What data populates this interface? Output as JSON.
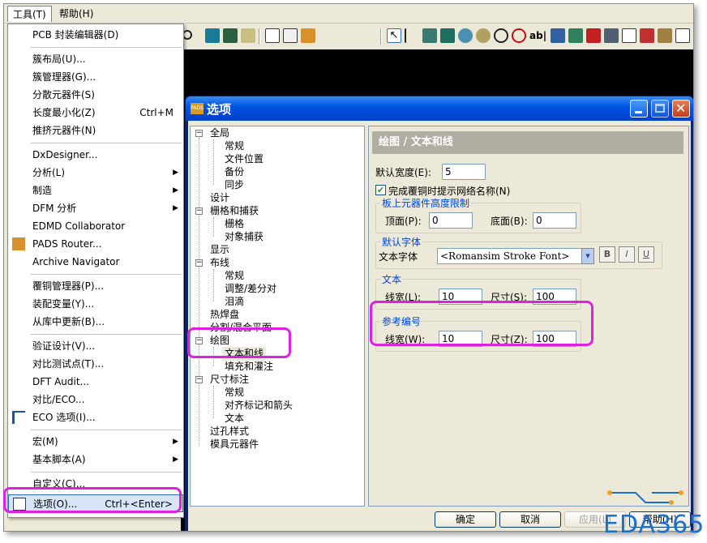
{
  "menubar": {
    "tools": "工具(T)",
    "help": "帮助(H)"
  },
  "tools_menu": {
    "items": [
      {
        "label": "PCB 封装编辑器(D)",
        "shortcut": "",
        "submenu": false
      },
      {
        "label": "簇布局(U)...",
        "shortcut": "",
        "submenu": false
      },
      {
        "label": "簇管理器(G)...",
        "shortcut": "",
        "submenu": false
      },
      {
        "label": "分散元器件(S)",
        "shortcut": "",
        "submenu": false
      },
      {
        "label": "长度最小化(Z)",
        "shortcut": "Ctrl+M",
        "submenu": false
      },
      {
        "label": "推挤元器件(N)",
        "shortcut": "",
        "submenu": false
      },
      {
        "label": "DxDesigner...",
        "shortcut": "",
        "submenu": false
      },
      {
        "label": "分析(L)",
        "shortcut": "",
        "submenu": true
      },
      {
        "label": "制造",
        "shortcut": "",
        "submenu": true
      },
      {
        "label": "DFM 分析",
        "shortcut": "",
        "submenu": true
      },
      {
        "label": "EDMD Collaborator",
        "shortcut": "",
        "submenu": false
      },
      {
        "label": "PADS Router...",
        "shortcut": "",
        "submenu": false
      },
      {
        "label": "Archive Navigator",
        "shortcut": "",
        "submenu": false
      },
      {
        "label": "覆铜管理器(P)...",
        "shortcut": "",
        "submenu": false
      },
      {
        "label": "装配变量(Y)...",
        "shortcut": "",
        "submenu": false
      },
      {
        "label": "从库中更新(B)...",
        "shortcut": "",
        "submenu": false
      },
      {
        "label": "验证设计(V)...",
        "shortcut": "",
        "submenu": false
      },
      {
        "label": "对比测试点(T)...",
        "shortcut": "",
        "submenu": false
      },
      {
        "label": "DFT Audit...",
        "shortcut": "",
        "submenu": false
      },
      {
        "label": "对比/ECO...",
        "shortcut": "",
        "submenu": false
      },
      {
        "label": "ECO 选项(I)...",
        "shortcut": "",
        "submenu": false
      },
      {
        "label": "宏(M)",
        "shortcut": "",
        "submenu": true
      },
      {
        "label": "基本脚本(A)",
        "shortcut": "",
        "submenu": true
      },
      {
        "label": "自定义(C)...",
        "shortcut": "",
        "submenu": false
      },
      {
        "label": "选项(O)...",
        "shortcut": "Ctrl+<Enter>",
        "submenu": false
      }
    ]
  },
  "dialog": {
    "title": "选项",
    "tree": [
      {
        "label": "全局",
        "level": 0,
        "expander": "-"
      },
      {
        "label": "常规",
        "level": 1
      },
      {
        "label": "文件位置",
        "level": 1
      },
      {
        "label": "备份",
        "level": 1
      },
      {
        "label": "同步",
        "level": 1
      },
      {
        "label": "设计",
        "level": 0
      },
      {
        "label": "栅格和捕获",
        "level": 0,
        "expander": "-"
      },
      {
        "label": "栅格",
        "level": 1
      },
      {
        "label": "对象捕获",
        "level": 1
      },
      {
        "label": "显示",
        "level": 0
      },
      {
        "label": "布线",
        "level": 0,
        "expander": "-"
      },
      {
        "label": "常规",
        "level": 1
      },
      {
        "label": "调整/差分对",
        "level": 1
      },
      {
        "label": "泪滴",
        "level": 1
      },
      {
        "label": "热焊盘",
        "level": 0
      },
      {
        "label": "分割/混合平面",
        "level": 0
      },
      {
        "label": "绘图",
        "level": 0,
        "expander": "-"
      },
      {
        "label": "文本和线",
        "level": 1,
        "selected": true
      },
      {
        "label": "填充和灌注",
        "level": 1
      },
      {
        "label": "尺寸标注",
        "level": 0,
        "expander": "-"
      },
      {
        "label": "常规",
        "level": 1
      },
      {
        "label": "对齐标记和箭头",
        "level": 1
      },
      {
        "label": "文本",
        "level": 1
      },
      {
        "label": "过孔样式",
        "level": 0
      },
      {
        "label": "模具元器件",
        "level": 0
      }
    ],
    "panel_title": "绘图 / 文本和线",
    "default_width_label": "默认宽度(E):",
    "default_width_value": "5",
    "show_net_name_label": "完成覆铜时提示网络名称(N)",
    "show_net_name_checked": true,
    "height_group": {
      "title": "板上元器件高度限制",
      "top_label": "顶面(P):",
      "top_value": "0",
      "bottom_label": "底面(B):",
      "bottom_value": "0"
    },
    "font_group": {
      "title": "默认字体",
      "font_label": "文本字体",
      "font_value": "<Romansim Stroke Font>",
      "bold": "B",
      "italic": "I",
      "underline": "U"
    },
    "text_group": {
      "title": "文本",
      "width_label": "线宽(L):",
      "width_value": "10",
      "size_label": "尺寸(S):",
      "size_value": "100"
    },
    "ref_group": {
      "title": "参考编号",
      "width_label": "线宽(W):",
      "width_value": "10",
      "size_label": "尺寸(Z):",
      "size_value": "100"
    },
    "buttons": {
      "ok": "确定",
      "cancel": "取消",
      "apply": "应用(L)",
      "help": "帮助(H)"
    }
  },
  "watermark": "EDA365",
  "colors": {
    "highlight": "#e020e0",
    "title_blue": "#0055e5",
    "group_title": "#0046d5"
  }
}
